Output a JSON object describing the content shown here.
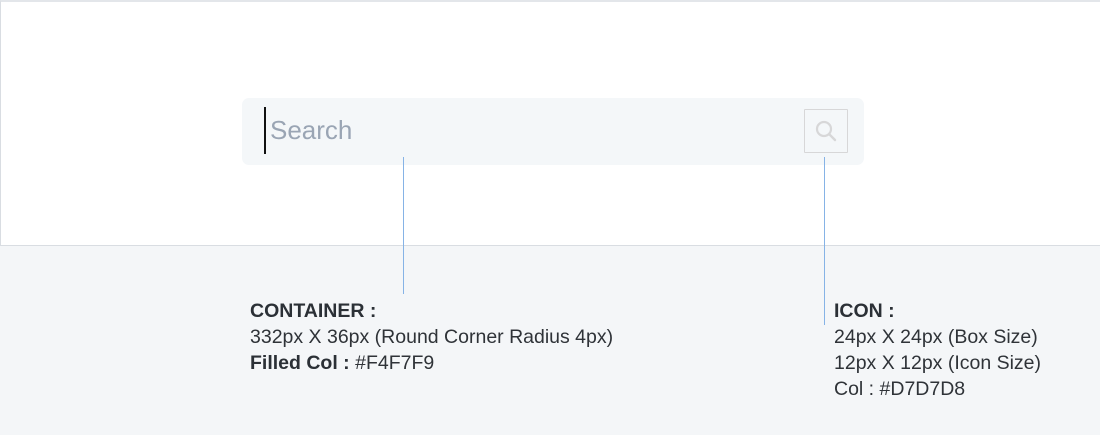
{
  "search": {
    "placeholder": "Search",
    "value": "",
    "icon": "search-icon"
  },
  "annotations": {
    "container": {
      "title": "CONTAINER :",
      "size": "332px X 36px (Round Corner Radius 4px)",
      "fill_label": "Filled Col :",
      "fill_value": "#F4F7F9"
    },
    "icon": {
      "title": "ICON :",
      "box_size": "24px X 24px (Box Size)",
      "icon_size": "12px X 12px (Icon Size)",
      "color": "Col : #D7D7D8"
    }
  },
  "colors": {
    "container_fill": "#F4F7F9",
    "icon_color": "#D7D7D8",
    "leader_line": "#86B3E6"
  }
}
